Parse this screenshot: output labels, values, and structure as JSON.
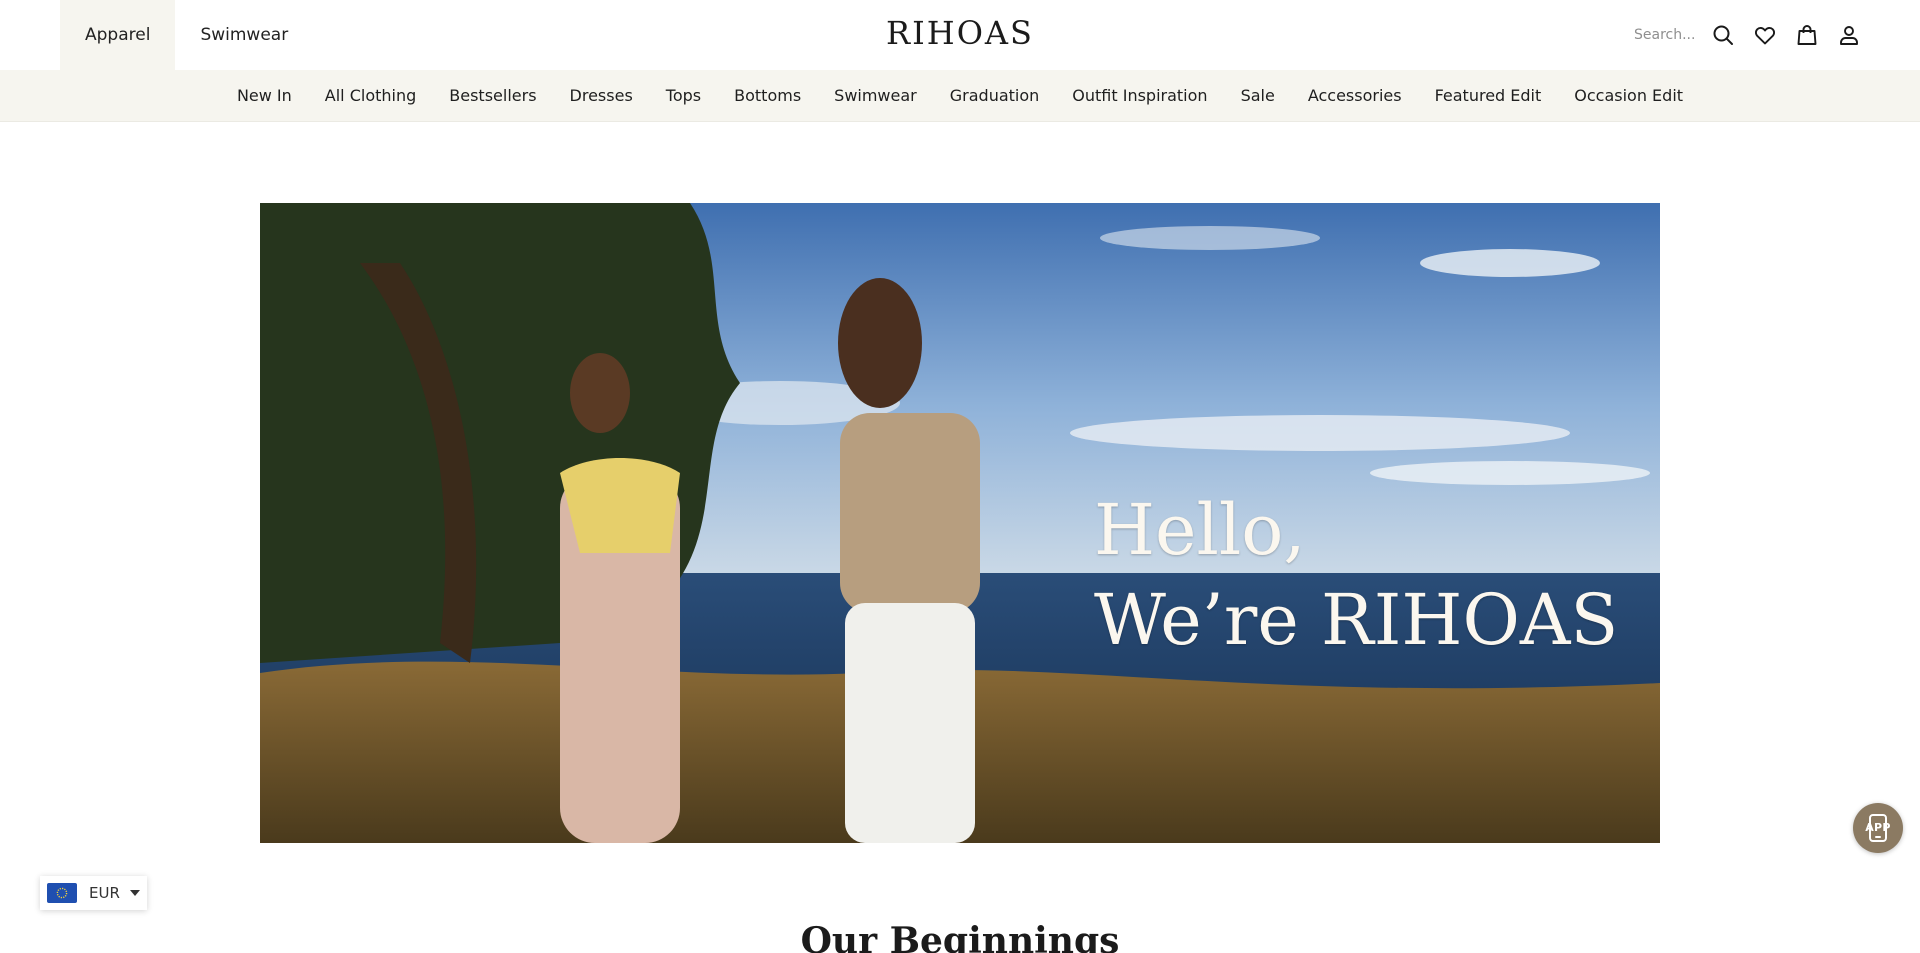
{
  "header": {
    "site_tabs": [
      {
        "label": "Apparel",
        "active": true
      },
      {
        "label": "Swimwear",
        "active": false
      }
    ],
    "logo": "RIHOAS",
    "search": {
      "placeholder": "Search..."
    },
    "icons": [
      "search-icon",
      "heart-icon",
      "bag-icon",
      "user-icon"
    ]
  },
  "nav": {
    "items": [
      "New In",
      "All Clothing",
      "Bestsellers",
      "Dresses",
      "Tops",
      "Bottoms",
      "Swimwear",
      "Graduation",
      "Outfit Inspiration",
      "Sale",
      "Accessories",
      "Featured Edit",
      "Occasion Edit"
    ]
  },
  "hero": {
    "line1": "Hello,",
    "line2": "We’re RIHOAS"
  },
  "section": {
    "title": "Our Beginnings"
  },
  "currency": {
    "code": "EUR",
    "flag": "eu-flag-icon"
  },
  "app_button": {
    "label": "APP"
  },
  "colors": {
    "nav_background": "#f6f5ef",
    "active_tab": "#f6f5ef",
    "app_button": "#8b7a62",
    "flag_blue": "#1f4fb0"
  }
}
